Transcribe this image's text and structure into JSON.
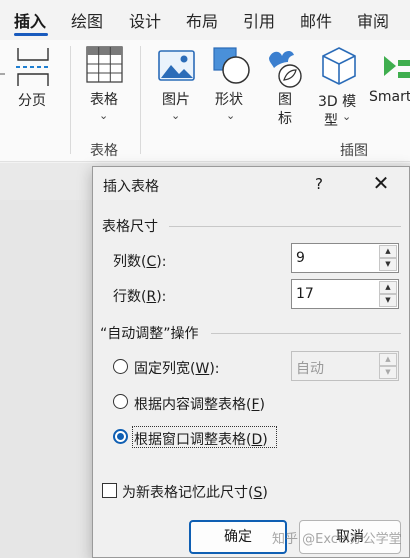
{
  "ribbon": {
    "tabs": [
      "插入",
      "绘图",
      "设计",
      "布局",
      "引用",
      "邮件",
      "审阅"
    ],
    "active_tab": "插入",
    "items": {
      "page_break": "分页",
      "table": "表格",
      "picture": "图片",
      "shapes": "形状",
      "icons_1": "图",
      "icons_2": "标",
      "model3d_1": "3D 模",
      "model3d_2": "型",
      "smartart": "Smart"
    },
    "groups": {
      "tables": "表格",
      "illustrations": "插图"
    }
  },
  "dialog": {
    "title": "插入表格",
    "help": "?",
    "close": "✕",
    "section_size": "表格尺寸",
    "columns_label": "列数(",
    "columns_key": "C",
    "columns_suffix": "):",
    "columns_value": "9",
    "rows_label": "行数(",
    "rows_key": "R",
    "rows_suffix": "):",
    "rows_value": "17",
    "section_autofit": "“自动调整”操作",
    "fixed_width_label": "固定列宽(",
    "fixed_width_key": "W",
    "fixed_width_suffix": "):",
    "fixed_width_value": "自动",
    "autofit_content_label": "根据内容调整表格(",
    "autofit_content_key": "F",
    "autofit_content_suffix": ")",
    "autofit_window_label": "根据窗口调整表格(",
    "autofit_window_key": "D",
    "autofit_window_suffix": ")",
    "selected_option": "autofit_window",
    "remember_label": "为新表格记忆此尺寸(",
    "remember_key": "S",
    "remember_suffix": ")",
    "remember_checked": false,
    "ok": "确定",
    "cancel": "取消"
  },
  "watermark": "知乎 @Excel办公学堂",
  "colors": {
    "accent": "#185abd",
    "radio_selected": "#0f5fb3"
  }
}
